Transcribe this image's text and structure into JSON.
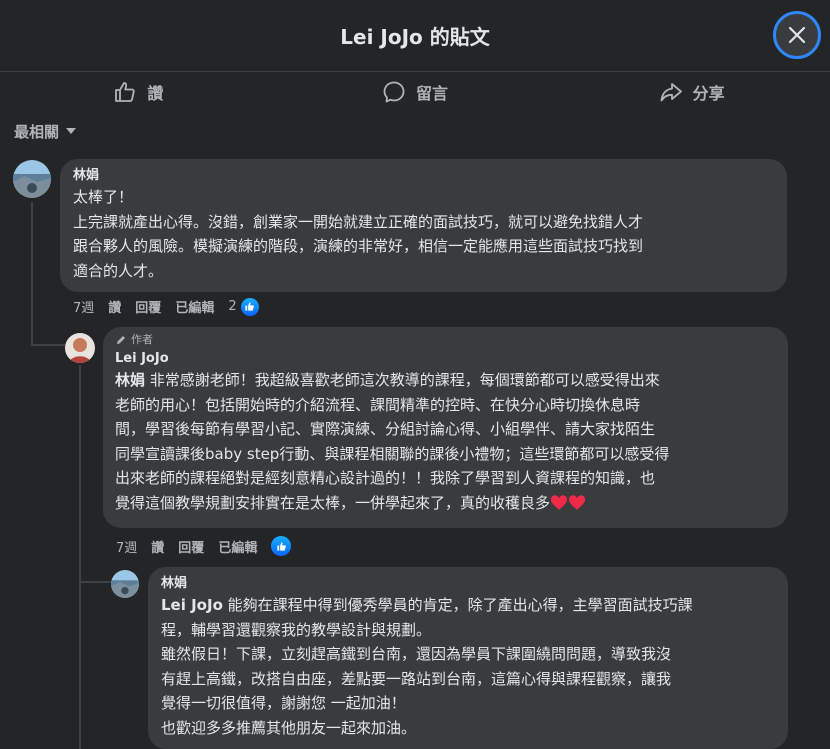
{
  "header": {
    "title": "Lei JoJo 的貼文"
  },
  "actions": {
    "like": "讚",
    "comment": "留言",
    "share": "分享"
  },
  "sort": {
    "label": "最相關"
  },
  "comments": [
    {
      "author": "林娟",
      "text": "太棒了！\n上完課就產出心得。沒錯，創業家一開始就建立正確的面試技巧，就可以避免找錯人才\n跟合夥人的風險。模擬演練的階段，演練的非常好，相信一定能應用這些面試技巧找到\n適合的人才。",
      "meta": {
        "time": "7週",
        "like": "讚",
        "reply": "回覆",
        "edited": "已編輯",
        "reactions": "2"
      }
    },
    {
      "author_tag": "作者",
      "author": "Lei JoJo",
      "mention": "林娟",
      "text": " 非常感謝老師！我超級喜歡老師這次教導的課程，每個環節都可以感受得出來\n老師的用心！包括開始時的介紹流程、課間精準的控時、在快分心時切換休息時\n間，學習後每節有學習小記、實際演練、分組討論心得、小組學伴、請大家找陌生\n同學宣讀課後baby step行動、與課程相關聯的課後小禮物；這些環節都可以感受得\n出來老師的課程絕對是經刻意精心設計過的！！我除了學習到人資課程的知識，也\n覺得這個教學規劃安排實在是太棒，一併學起來了，真的收穫良多",
      "meta": {
        "time": "7週",
        "like": "讚",
        "reply": "回覆",
        "edited": "已編輯"
      }
    },
    {
      "author": "林娟",
      "mention": "Lei JoJo",
      "text": " 能夠在課程中得到優秀學員的肯定，除了產出心得，主學習面試技巧課\n程，輔學習還觀察我的教學設計與規劃。\n雖然假日！下課，立刻趕高鐵到台南，還因為學員下課圍繞問問題，導致我沒\n有趕上高鐵，改搭自由座，差點要一路站到台南，這篇心得與課程觀察，讓我\n覺得一切很值得，謝謝您 一起加油！\n也歡迎多多推薦其他朋友一起來加油。"
    }
  ],
  "colors": {
    "accent": "#2d88ff",
    "background": "#242526",
    "bubble": "#3a3b3c",
    "heart": "#f02849"
  }
}
